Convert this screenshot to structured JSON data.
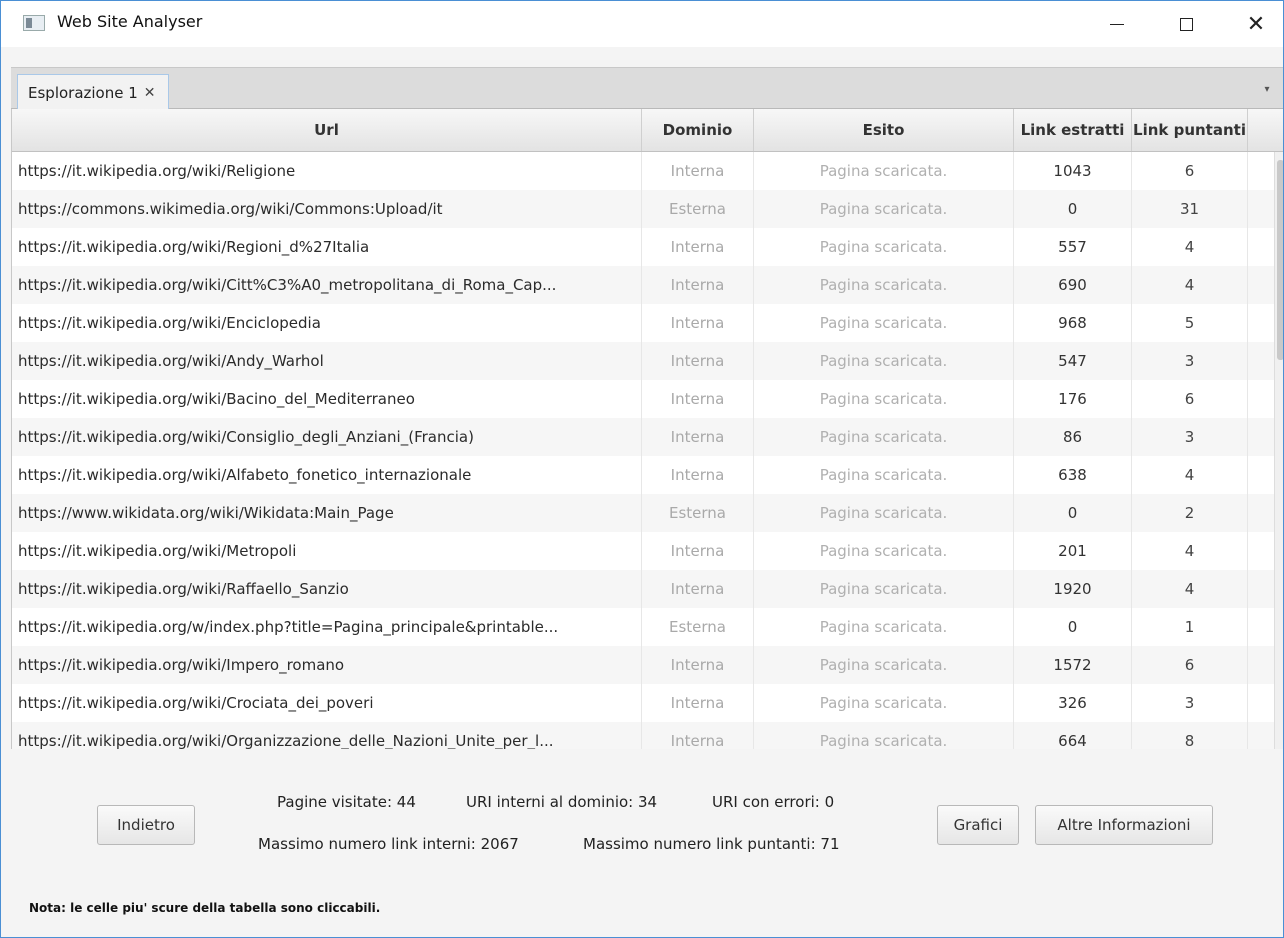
{
  "window": {
    "title": "Web Site Analyser",
    "minimize_icon": "minimize-icon",
    "maximize_icon": "maximize-icon",
    "close_icon": "close-icon"
  },
  "tabs": [
    {
      "label": "Esplorazione 1",
      "close": "✕"
    }
  ],
  "tab_menu": "▾",
  "table": {
    "headers": {
      "url": "Url",
      "dominio": "Dominio",
      "esito": "Esito",
      "link_estratti": "Link estratti",
      "link_puntanti": "Link puntanti"
    },
    "rows": [
      {
        "url": "https://it.wikipedia.org/wiki/Religione",
        "dominio": "Interna",
        "esito": "Pagina scaricata.",
        "link_estratti": "1043",
        "link_puntanti": "6"
      },
      {
        "url": "https://commons.wikimedia.org/wiki/Commons:Upload/it",
        "dominio": "Esterna",
        "esito": "Pagina scaricata.",
        "link_estratti": "0",
        "link_puntanti": "31"
      },
      {
        "url": "https://it.wikipedia.org/wiki/Regioni_d%27Italia",
        "dominio": "Interna",
        "esito": "Pagina scaricata.",
        "link_estratti": "557",
        "link_puntanti": "4"
      },
      {
        "url": "https://it.wikipedia.org/wiki/Citt%C3%A0_metropolitana_di_Roma_Cap...",
        "dominio": "Interna",
        "esito": "Pagina scaricata.",
        "link_estratti": "690",
        "link_puntanti": "4"
      },
      {
        "url": "https://it.wikipedia.org/wiki/Enciclopedia",
        "dominio": "Interna",
        "esito": "Pagina scaricata.",
        "link_estratti": "968",
        "link_puntanti": "5"
      },
      {
        "url": "https://it.wikipedia.org/wiki/Andy_Warhol",
        "dominio": "Interna",
        "esito": "Pagina scaricata.",
        "link_estratti": "547",
        "link_puntanti": "3"
      },
      {
        "url": "https://it.wikipedia.org/wiki/Bacino_del_Mediterraneo",
        "dominio": "Interna",
        "esito": "Pagina scaricata.",
        "link_estratti": "176",
        "link_puntanti": "6"
      },
      {
        "url": "https://it.wikipedia.org/wiki/Consiglio_degli_Anziani_(Francia)",
        "dominio": "Interna",
        "esito": "Pagina scaricata.",
        "link_estratti": "86",
        "link_puntanti": "3"
      },
      {
        "url": "https://it.wikipedia.org/wiki/Alfabeto_fonetico_internazionale",
        "dominio": "Interna",
        "esito": "Pagina scaricata.",
        "link_estratti": "638",
        "link_puntanti": "4"
      },
      {
        "url": "https://www.wikidata.org/wiki/Wikidata:Main_Page",
        "dominio": "Esterna",
        "esito": "Pagina scaricata.",
        "link_estratti": "0",
        "link_puntanti": "2"
      },
      {
        "url": "https://it.wikipedia.org/wiki/Metropoli",
        "dominio": "Interna",
        "esito": "Pagina scaricata.",
        "link_estratti": "201",
        "link_puntanti": "4"
      },
      {
        "url": "https://it.wikipedia.org/wiki/Raffaello_Sanzio",
        "dominio": "Interna",
        "esito": "Pagina scaricata.",
        "link_estratti": "1920",
        "link_puntanti": "4"
      },
      {
        "url": "https://it.wikipedia.org/w/index.php?title=Pagina_principale&printable...",
        "dominio": "Esterna",
        "esito": "Pagina scaricata.",
        "link_estratti": "0",
        "link_puntanti": "1"
      },
      {
        "url": "https://it.wikipedia.org/wiki/Impero_romano",
        "dominio": "Interna",
        "esito": "Pagina scaricata.",
        "link_estratti": "1572",
        "link_puntanti": "6"
      },
      {
        "url": "https://it.wikipedia.org/wiki/Crociata_dei_poveri",
        "dominio": "Interna",
        "esito": "Pagina scaricata.",
        "link_estratti": "326",
        "link_puntanti": "3"
      },
      {
        "url": "https://it.wikipedia.org/wiki/Organizzazione_delle_Nazioni_Unite_per_l...",
        "dominio": "Interna",
        "esito": "Pagina scaricata.",
        "link_estratti": "664",
        "link_puntanti": "8"
      }
    ]
  },
  "footer": {
    "back_button": "Indietro",
    "pagine_visitate": "Pagine visitate: 44",
    "uri_interni": "URI interni al dominio: 34",
    "uri_errori": "URI con errori: 0",
    "max_link_interni": "Massimo numero link interni: 2067",
    "max_link_puntanti": "Massimo numero link puntanti: 71",
    "grafici_button": "Grafici",
    "altre_button": "Altre Informazioni",
    "nota": "Nota: le celle piu' scure della tabella sono cliccabili."
  }
}
